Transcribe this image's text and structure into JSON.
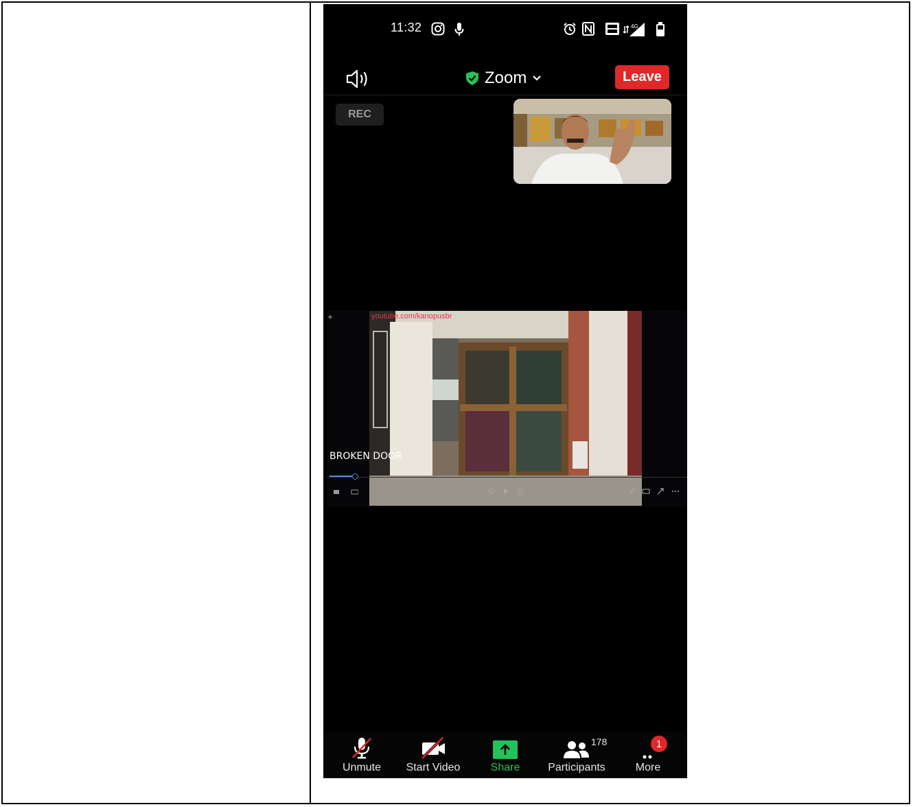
{
  "status_bar": {
    "time": "11:32",
    "icons": [
      "instagram-icon",
      "microphone-icon",
      "alarm-icon",
      "nfc-icon",
      "volte-icon",
      "signal-4g-icon",
      "battery-icon"
    ]
  },
  "header": {
    "meeting_title": "Zoom",
    "leave_label": "Leave",
    "icons": [
      "speaker-icon",
      "shield-check-icon",
      "chevron-down-icon"
    ]
  },
  "recording": {
    "label": "REC"
  },
  "shared_screen": {
    "url_overlay": "youtube.com/kanopusbr",
    "caption": "BROKEN DOOR"
  },
  "toolbar": {
    "items": [
      {
        "label": "Unmute",
        "icon": "muted-mic-icon"
      },
      {
        "label": "Start Video",
        "icon": "video-off-icon"
      },
      {
        "label": "Share",
        "icon": "share-arrow-icon"
      },
      {
        "label": "Participants",
        "icon": "participants-icon"
      },
      {
        "label": "More",
        "icon": "more-dots-icon"
      }
    ],
    "participants_count": "178",
    "more_badge": "1"
  },
  "colors": {
    "leave": "#e02828",
    "share_accent": "#21c35a",
    "shield": "#2bbf55",
    "background": "#000000"
  }
}
